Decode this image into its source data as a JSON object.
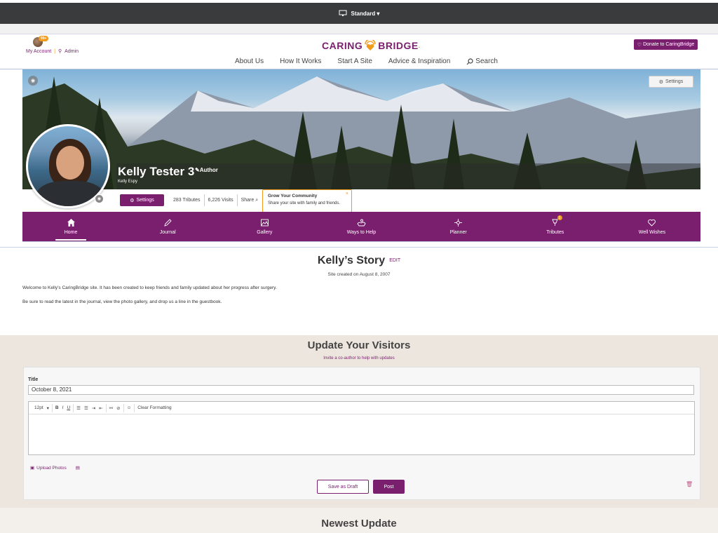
{
  "topbar": {
    "view_label": "Standard",
    "icon": "monitor-icon"
  },
  "header": {
    "account_badge": "99+",
    "my_account": "My Account",
    "admin": "Admin",
    "logo_left": "CARING",
    "logo_right": "BRIDGE",
    "logo_mark": ".",
    "nav": [
      "About Us",
      "How It Works",
      "Start A Site",
      "Advice & Inspiration",
      "Search"
    ],
    "donate_label": "Donate to CaringBridge"
  },
  "banner": {
    "settings_label": "Settings",
    "name": "Kelly Tester 3",
    "role": "Author",
    "subname": "Kelly Espy"
  },
  "stats": {
    "settings_label": "Settings",
    "tributes": "283 Tributes",
    "visits": "6,226 Visits",
    "share": "Share"
  },
  "tooltip": {
    "title": "Grow Your Community",
    "body": "Share your site with family and friends."
  },
  "tabs": [
    {
      "label": "Home",
      "icon": "home-icon"
    },
    {
      "label": "Journal",
      "icon": "pencil-icon"
    },
    {
      "label": "Gallery",
      "icon": "gallery-icon"
    },
    {
      "label": "Ways to Help",
      "icon": "helping-hands-icon"
    },
    {
      "label": "Planner",
      "icon": "planner-icon"
    },
    {
      "label": "Tributes",
      "icon": "tribute-icon",
      "badge": "1"
    },
    {
      "label": "Well Wishes",
      "icon": "heart-icon"
    }
  ],
  "story": {
    "title": "Kelly’s Story",
    "edit": "EDIT",
    "created": "Site created on August 8, 2007",
    "p1": "Welcome to Kelly’s CaringBridge site. It has been created to keep friends and family updated about her progress after surgery.",
    "p2": "Be sure to read the latest in the journal, view the photo gallery, and drop us a line in the guestbook."
  },
  "update": {
    "title": "Update Your Visitors",
    "subtitle": "Invite a co-author to help with updates",
    "title_label": "Title",
    "title_value": "October 8, 2021",
    "font_size": "12pt",
    "toolbar": [
      "B",
      "I",
      "U"
    ],
    "clear_formatting": "Clear Formatting",
    "upload_photos": "Upload Photos",
    "save_draft": "Save as Draft",
    "post": "Post"
  },
  "newest": {
    "title": "Newest Update"
  },
  "colors": {
    "brand": "#7a1e6e",
    "accent": "#f29a1a"
  }
}
